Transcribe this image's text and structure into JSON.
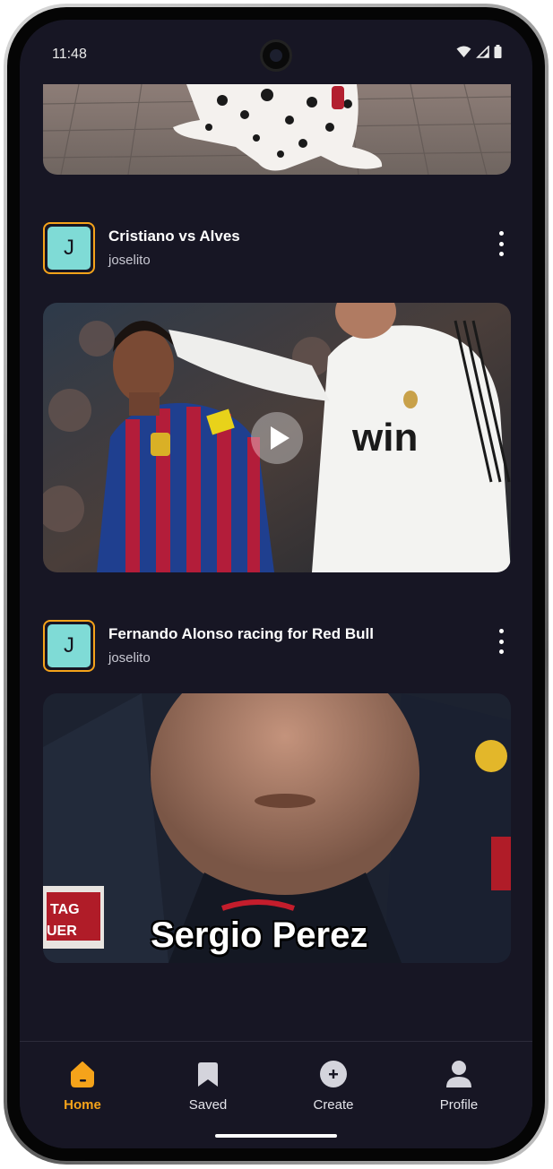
{
  "status_bar": {
    "time": "11:48"
  },
  "posts": [
    {
      "title": "Cristiano vs Alves",
      "user": "joselito",
      "avatar_letter": "J",
      "media": "video"
    },
    {
      "title": "Fernando Alonso racing for Red Bull",
      "user": "joselito",
      "avatar_letter": "J",
      "media": "video",
      "caption": "Sergio Perez"
    }
  ],
  "bottom_nav": {
    "items": [
      {
        "label": "Home",
        "icon": "home-icon",
        "active": true
      },
      {
        "label": "Saved",
        "icon": "bookmark-icon",
        "active": false
      },
      {
        "label": "Create",
        "icon": "add-circle-icon",
        "active": false
      },
      {
        "label": "Profile",
        "icon": "person-icon",
        "active": false
      }
    ]
  },
  "colors": {
    "background": "#171624",
    "accent": "#f5a31a",
    "avatar": "#7fdbd6"
  }
}
